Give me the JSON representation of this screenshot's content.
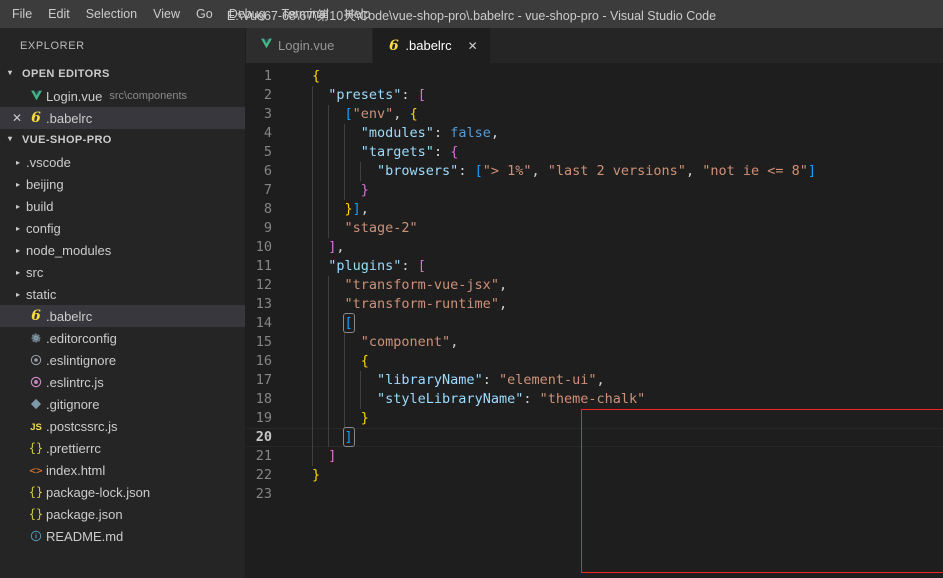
{
  "titlebar": {
    "menus": [
      "File",
      "Edit",
      "Selection",
      "View",
      "Go",
      "Debug",
      "Terminal",
      "Help"
    ],
    "window_title": "E:\\Vue67-68\\67\\第10天\\Code\\vue-shop-pro\\.babelrc - vue-shop-pro - Visual Studio Code"
  },
  "sidebar": {
    "title": "EXPLORER",
    "open_editors": {
      "header": "OPEN EDITORS",
      "twisty": "▾",
      "items": [
        {
          "name": "Login.vue",
          "detail": "src\\components",
          "icon": "vue-icon",
          "close": "✕",
          "selected": false,
          "dirty": false
        },
        {
          "name": ".babelrc",
          "detail": "",
          "icon": "babel-icon",
          "close": "✕",
          "selected": true,
          "dirty": false
        }
      ]
    },
    "project": {
      "header": "VUE-SHOP-PRO",
      "twisty": "▾",
      "folders": [
        {
          "name": ".vscode",
          "arrow": "▸"
        },
        {
          "name": "beijing",
          "arrow": "▸"
        },
        {
          "name": "build",
          "arrow": "▸"
        },
        {
          "name": "config",
          "arrow": "▸"
        },
        {
          "name": "node_modules",
          "arrow": "▸"
        },
        {
          "name": "src",
          "arrow": "▸"
        },
        {
          "name": "static",
          "arrow": "▸"
        }
      ],
      "files": [
        {
          "name": ".babelrc",
          "icon": "babel-icon",
          "selected": true
        },
        {
          "name": ".editorconfig",
          "icon": "gear-icon",
          "selected": false
        },
        {
          "name": ".eslintignore",
          "icon": "eslint-dim-icon",
          "selected": false
        },
        {
          "name": ".eslintrc.js",
          "icon": "eslint-icon",
          "selected": false
        },
        {
          "name": ".gitignore",
          "icon": "git-icon",
          "selected": false
        },
        {
          "name": ".postcssrc.js",
          "icon": "js-icon",
          "selected": false
        },
        {
          "name": ".prettierrc",
          "icon": "json-icon",
          "selected": false
        },
        {
          "name": "index.html",
          "icon": "html-icon",
          "selected": false
        },
        {
          "name": "package-lock.json",
          "icon": "json-icon",
          "selected": false
        },
        {
          "name": "package.json",
          "icon": "json-icon",
          "selected": false
        },
        {
          "name": "README.md",
          "icon": "markdown-icon",
          "selected": false
        }
      ]
    }
  },
  "tabs": [
    {
      "label": "Login.vue",
      "icon": "vue-icon",
      "active": false,
      "close": "✕"
    },
    {
      "label": ".babelrc",
      "icon": "babel-icon",
      "active": true,
      "close": "✕"
    }
  ],
  "editor": {
    "current_line": 20,
    "total_lines": 23,
    "language": "json",
    "modified_range": [
      11,
      21
    ],
    "lines": [
      {
        "n": 1,
        "text": "{"
      },
      {
        "n": 2,
        "text": "  \"presets\": ["
      },
      {
        "n": 3,
        "text": "    [\"env\", {"
      },
      {
        "n": 4,
        "text": "      \"modules\": false,"
      },
      {
        "n": 5,
        "text": "      \"targets\": {"
      },
      {
        "n": 6,
        "text": "        \"browsers\": [\"> 1%\", \"last 2 versions\", \"not ie <= 8\"]"
      },
      {
        "n": 7,
        "text": "      }"
      },
      {
        "n": 8,
        "text": "    }],"
      },
      {
        "n": 9,
        "text": "    \"stage-2\""
      },
      {
        "n": 10,
        "text": "  ],"
      },
      {
        "n": 11,
        "text": "  \"plugins\": ["
      },
      {
        "n": 12,
        "text": "    \"transform-vue-jsx\","
      },
      {
        "n": 13,
        "text": "    \"transform-runtime\","
      },
      {
        "n": 14,
        "text": "    ["
      },
      {
        "n": 15,
        "text": "      \"component\","
      },
      {
        "n": 16,
        "text": "      {"
      },
      {
        "n": 17,
        "text": "        \"libraryName\": \"element-ui\","
      },
      {
        "n": 18,
        "text": "        \"styleLibraryName\": \"theme-chalk\""
      },
      {
        "n": 19,
        "text": "      }"
      },
      {
        "n": 20,
        "text": "    ]"
      },
      {
        "n": 21,
        "text": "  ]"
      },
      {
        "n": 22,
        "text": "}"
      },
      {
        "n": 23,
        "text": ""
      }
    ]
  },
  "annotation": {
    "type": "rectangle",
    "color": "#f22424",
    "covers_lines": [
      14,
      20
    ]
  },
  "colors": {
    "background": "#1e1e1e",
    "sidebar_background": "#252526",
    "titlebar_background": "#3c3c3c",
    "tab_active_background": "#1e1e1e",
    "tab_inactive_background": "#2d2d2d",
    "selection": "#37373d",
    "key": "#9cdcfe",
    "string": "#ce9178",
    "keyword": "#569cd6",
    "line_number": "#858585",
    "git_modified": "#1b9ccb",
    "annotation": "#f22424"
  }
}
